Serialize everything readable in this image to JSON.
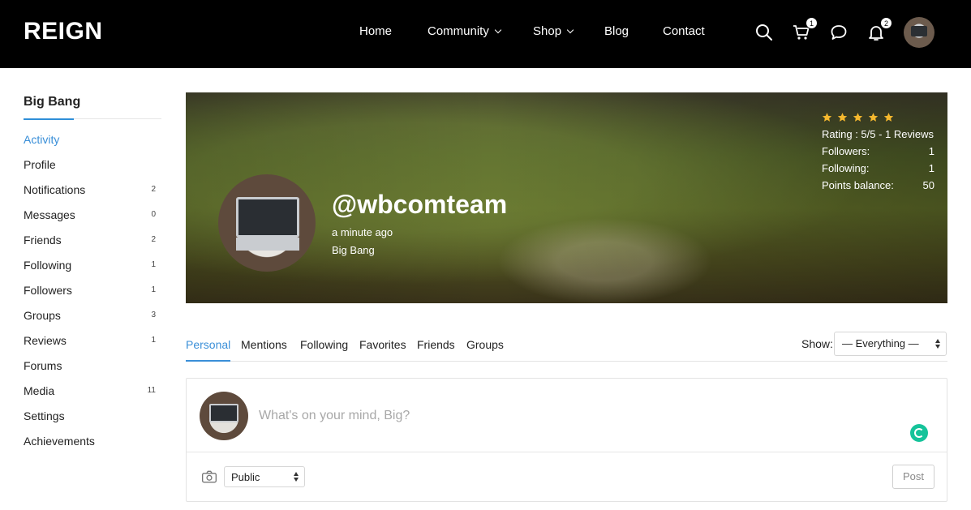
{
  "header": {
    "brand": "REIGN",
    "nav": [
      {
        "label": "Home",
        "dropdown": false
      },
      {
        "label": "Community",
        "dropdown": true
      },
      {
        "label": "Shop",
        "dropdown": true
      },
      {
        "label": "Blog",
        "dropdown": false
      },
      {
        "label": "Contact",
        "dropdown": false
      }
    ],
    "icons": {
      "search": "search-icon",
      "cart": "cart-icon",
      "messages": "chat-bubble-icon",
      "notifications": "bell-icon"
    },
    "cart_count": "1",
    "notification_count": "2"
  },
  "sidebar": {
    "title": "Big Bang",
    "items": [
      {
        "label": "Activity",
        "count": "",
        "active": true
      },
      {
        "label": "Profile",
        "count": ""
      },
      {
        "label": "Notifications",
        "count": "2"
      },
      {
        "label": "Messages",
        "count": "0"
      },
      {
        "label": "Friends",
        "count": "2"
      },
      {
        "label": "Following",
        "count": "1"
      },
      {
        "label": "Followers",
        "count": "1"
      },
      {
        "label": "Groups",
        "count": "3"
      },
      {
        "label": "Reviews",
        "count": "1"
      },
      {
        "label": "Forums",
        "count": ""
      },
      {
        "label": "Media",
        "count": "11"
      },
      {
        "label": "Settings",
        "count": ""
      },
      {
        "label": "Achievements",
        "count": ""
      }
    ],
    "accent": "#3a8fd8"
  },
  "cover": {
    "username": "@wbcomteam",
    "last_active": "a minute ago",
    "display_name": "Big Bang",
    "stars": 5,
    "star_color": "#f5b82e",
    "rating_text": "Rating : 5/5 - 1 Reviews",
    "stats": [
      {
        "label": "Followers:",
        "value": "1"
      },
      {
        "label": "Following:",
        "value": "1"
      },
      {
        "label": "Points balance:",
        "value": "50"
      }
    ]
  },
  "tabs": [
    {
      "label": "Personal",
      "active": true
    },
    {
      "label": "Mentions"
    },
    {
      "label": "Following"
    },
    {
      "label": "Favorites"
    },
    {
      "label": "Friends"
    },
    {
      "label": "Groups"
    }
  ],
  "filter": {
    "label": "Show:",
    "selected": "— Everything —"
  },
  "post": {
    "placeholder": "What's on your mind, Big?",
    "privacy": "Public",
    "submit": "Post"
  }
}
